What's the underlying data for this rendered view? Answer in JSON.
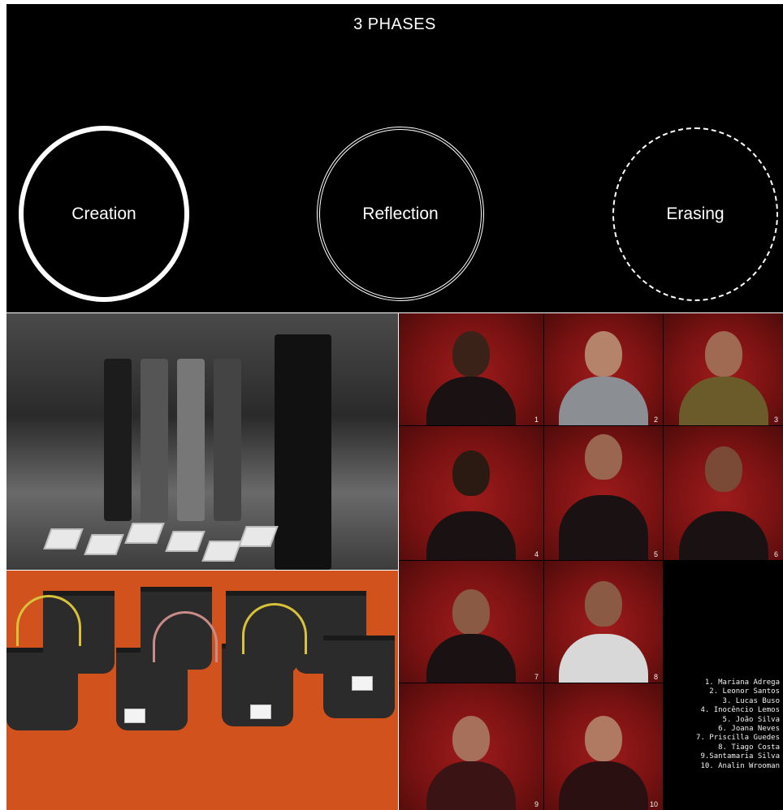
{
  "phases": {
    "title": "3 PHASES",
    "items": [
      "Creation",
      "Reflection",
      "Erasing"
    ]
  },
  "portraits": {
    "numbers": [
      "1",
      "2",
      "3",
      "4",
      "5",
      "6",
      "7",
      "8",
      "9",
      "10"
    ],
    "names": [
      "1. Mariana Adrega",
      "2. Leonor Santos",
      "3. Lucas Buso",
      "4. Inocêncio Lemos",
      "5. João Silva",
      "6. Joana Neves",
      "7. Priscilla Guedes",
      "8. Tiago Costa",
      "9.Santamaria Silva",
      "10. Analin Wrooman"
    ]
  }
}
